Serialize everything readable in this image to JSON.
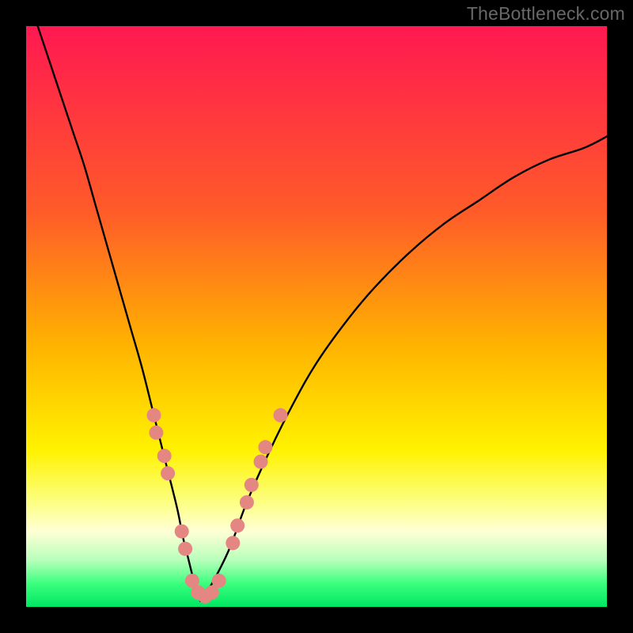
{
  "attribution": "TheBottleneck.com",
  "chart_data": {
    "type": "line",
    "title": "",
    "xlabel": "",
    "ylabel": "",
    "xlim": [
      0,
      100
    ],
    "ylim": [
      0,
      100
    ],
    "grid": false,
    "legend": false,
    "background_gradient_stops": [
      {
        "offset": 0.0,
        "color": "#ff1851"
      },
      {
        "offset": 0.32,
        "color": "#ff5b29"
      },
      {
        "offset": 0.55,
        "color": "#ffb300"
      },
      {
        "offset": 0.73,
        "color": "#fff200"
      },
      {
        "offset": 0.82,
        "color": "#fcff82"
      },
      {
        "offset": 0.87,
        "color": "#ffffd6"
      },
      {
        "offset": 0.92,
        "color": "#b7ffba"
      },
      {
        "offset": 0.96,
        "color": "#3aff7d"
      },
      {
        "offset": 1.0,
        "color": "#00e763"
      }
    ],
    "series": [
      {
        "name": "left-curve",
        "x": [
          2,
          4,
          6,
          8,
          10,
          12,
          14,
          16,
          18,
          20,
          22,
          24,
          26,
          27,
          28,
          29,
          30
        ],
        "y": [
          100,
          94,
          88,
          82,
          76,
          69,
          62,
          55,
          48,
          41,
          33,
          25,
          17,
          12,
          8,
          4,
          1
        ]
      },
      {
        "name": "right-curve",
        "x": [
          30,
          32,
          35,
          38,
          42,
          46,
          50,
          55,
          60,
          66,
          72,
          78,
          84,
          90,
          96,
          100
        ],
        "y": [
          1,
          4,
          10,
          18,
          27,
          35,
          42,
          49,
          55,
          61,
          66,
          70,
          74,
          77,
          79,
          81
        ]
      }
    ],
    "markers": {
      "name": "highlight-dots",
      "color": "#e48682",
      "radius": 9,
      "points": [
        {
          "x": 22.0,
          "y": 33
        },
        {
          "x": 22.4,
          "y": 30
        },
        {
          "x": 23.8,
          "y": 26
        },
        {
          "x": 24.4,
          "y": 23
        },
        {
          "x": 26.8,
          "y": 13
        },
        {
          "x": 27.4,
          "y": 10
        },
        {
          "x": 28.6,
          "y": 4.5
        },
        {
          "x": 29.6,
          "y": 2.5
        },
        {
          "x": 30.8,
          "y": 1.8
        },
        {
          "x": 32.0,
          "y": 2.5
        },
        {
          "x": 33.2,
          "y": 4.5
        },
        {
          "x": 35.6,
          "y": 11
        },
        {
          "x": 36.4,
          "y": 14
        },
        {
          "x": 38.0,
          "y": 18
        },
        {
          "x": 38.8,
          "y": 21
        },
        {
          "x": 40.4,
          "y": 25
        },
        {
          "x": 41.2,
          "y": 27.5
        },
        {
          "x": 43.8,
          "y": 33
        }
      ]
    }
  }
}
